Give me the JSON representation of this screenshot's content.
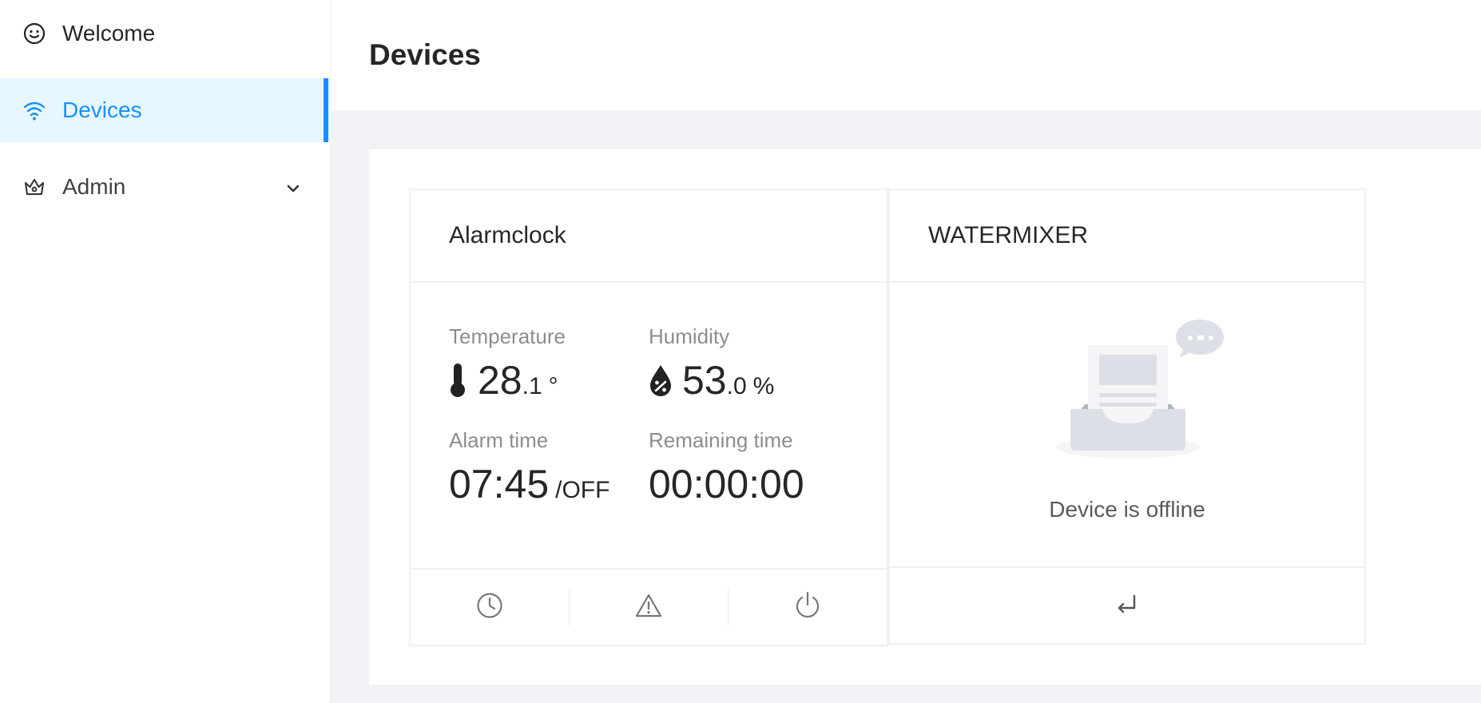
{
  "sidebar": {
    "items": [
      {
        "label": "Welcome",
        "icon": "smile-icon"
      },
      {
        "label": "Devices",
        "icon": "wifi-icon",
        "active": true
      },
      {
        "label": "Admin",
        "icon": "crown-icon",
        "expandable": true
      }
    ]
  },
  "header": {
    "title": "Devices"
  },
  "devices": [
    {
      "name": "Alarmclock",
      "stats": {
        "temperature": {
          "title": "Temperature",
          "int": "28",
          "dec": ".1",
          "unit": "°"
        },
        "humidity": {
          "title": "Humidity",
          "int": "53",
          "dec": ".0",
          "unit": "%"
        },
        "alarm_time": {
          "title": "Alarm time",
          "value": "07:45",
          "suffix": "/OFF"
        },
        "remaining_time": {
          "title": "Remaining time",
          "value": "00:00:00"
        }
      },
      "actions": [
        "clock-icon",
        "warning-icon",
        "power-icon"
      ]
    },
    {
      "name": "WATERMIXER",
      "status_text": "Device is offline",
      "actions": [
        "enter-icon"
      ]
    }
  ],
  "colors": {
    "accent": "#1890ff",
    "active_bg": "#e6f7ff",
    "page_bg": "#f0f2f5"
  }
}
